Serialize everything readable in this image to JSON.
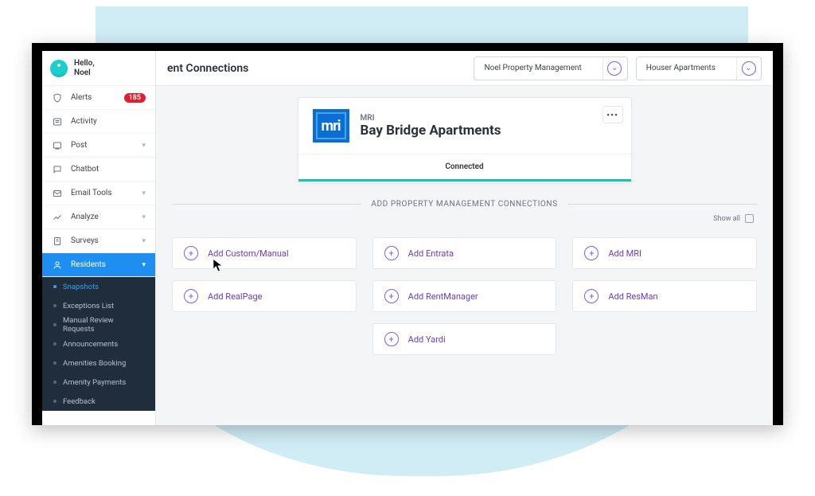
{
  "user": {
    "greeting": "Hello,",
    "name": "Noel"
  },
  "sidebar": {
    "items": [
      {
        "label": "Alerts",
        "icon": "shield",
        "badge": "185"
      },
      {
        "label": "Activity",
        "icon": "list"
      },
      {
        "label": "Post",
        "icon": "post",
        "expand": true
      },
      {
        "label": "Chatbot",
        "icon": "chat"
      },
      {
        "label": "Email Tools",
        "icon": "mail",
        "expand": true
      },
      {
        "label": "Analyze",
        "icon": "analyze",
        "expand": true
      },
      {
        "label": "Surveys",
        "icon": "survey",
        "expand": true
      },
      {
        "label": "Residents",
        "icon": "residents",
        "expand": true,
        "active": true
      }
    ],
    "sub": [
      {
        "label": "Snapshots",
        "selected": true
      },
      {
        "label": "Exceptions List"
      },
      {
        "label": "Manual Review Requests"
      },
      {
        "label": "Announcements"
      },
      {
        "label": "Amenities Booking"
      },
      {
        "label": "Amenity Payments"
      },
      {
        "label": "Feedback"
      }
    ]
  },
  "topbar": {
    "title_suffix": "ent Connections",
    "selector1": "Noel Property Management",
    "selector2": "Houser Apartments"
  },
  "card": {
    "provider": "MRI",
    "property": "Bay Bridge Apartments",
    "status": "Connected",
    "logo_text": "mri"
  },
  "section": {
    "heading": "ADD PROPERTY MANAGEMENT CONNECTIONS",
    "showall": "Show all"
  },
  "tiles": [
    "Add Custom/Manual",
    "Add Entrata",
    "Add MRI",
    "Add RealPage",
    "Add RentManager",
    "Add ResMan",
    "Add Yardi"
  ]
}
